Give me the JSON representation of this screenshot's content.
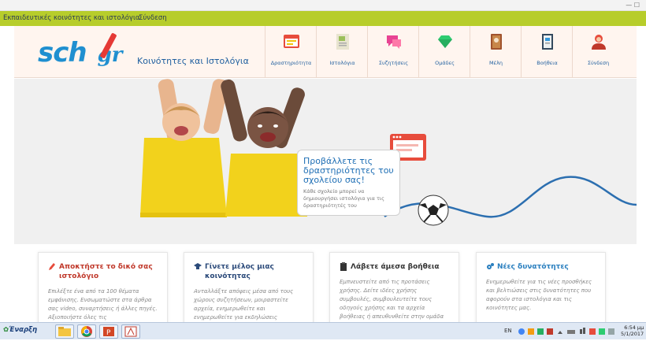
{
  "top_bar": {
    "link_communities": "Εκπαιδευτικές κοινότητες και ιστολόγια",
    "link_login": "Σύνδεση"
  },
  "header": {
    "logo_main": "sch",
    "logo_suffix": "gr",
    "tagline": "Κοινότητες και Ιστολόγια"
  },
  "nav": [
    {
      "label": "Δραστηριότητα",
      "icon": "activity-icon"
    },
    {
      "label": "Ιστολόγια",
      "icon": "blog-icon"
    },
    {
      "label": "Συζητήσεις",
      "icon": "discussion-icon"
    },
    {
      "label": "Ομάδες",
      "icon": "groups-icon"
    },
    {
      "label": "Μέλη",
      "icon": "members-icon"
    },
    {
      "label": "Βοήθεια",
      "icon": "help-icon"
    },
    {
      "label": "Σύνδεση",
      "icon": "login-icon"
    }
  ],
  "hero": {
    "callout_title": "Προβάλλετε τις δραστηριότητες του σχολείου σας!",
    "callout_body": "Κάθε σχολείο μπορεί να δημιουργήσει ιστολόγια για τις δραστηριότητές του"
  },
  "cards": [
    {
      "title": "Αποκτήστε το δικό σας ιστολόγιο",
      "body": "Επιλέξτε ένα από τα 100 θέματα εμφάνισης. Ενσωματώστε στα άρθρα σας video, συναρτήσεις ή άλλες πηγές. Αξιοποιήστε όλες τις",
      "icon": "pencil-icon",
      "color": "#c0392b"
    },
    {
      "title": "Γίνετε μέλος μιας κοινότητας",
      "body": "Ανταλλάξτε απόψεις μέσα από τους χώρους συζητήσεων, μοιραστείτε αρχεία, ενημερωθείτε και ενημερωθείτε για εκδηλώσεις",
      "icon": "mortarboard-icon",
      "color": "#2b4a7a"
    },
    {
      "title": "Λάβετε άμεσα βοήθεια",
      "body": "Εμπνευστείτε από τις προτάσεις χρήσης. Δείτε ιδέες χρήσης συμβουλές, συμβουλευτείτε τους οδηγούς χρήσης και τα αρχεία βοήθειας ή απευθυνθείτε στην ομάδα",
      "icon": "clipboard-icon",
      "color": "#333333"
    },
    {
      "title": "Νέες δυνατότητες",
      "body": "Ενημερωθείτε για τις νέες προσθήκες και βελτιώσεις στις δυνατότητες που αφορούν στα ιστολόγια και τις κοινότητες μας.",
      "icon": "gears-icon",
      "color": "#2a7fbf"
    }
  ],
  "taskbar": {
    "start_label": "Έναρξη",
    "lang": "EN",
    "time": "6:54 μμ",
    "date": "5/1/2017"
  },
  "colors": {
    "topbar": "#b7cd2b",
    "brand_blue": "#1f8fd0",
    "accent_red": "#e53935"
  }
}
